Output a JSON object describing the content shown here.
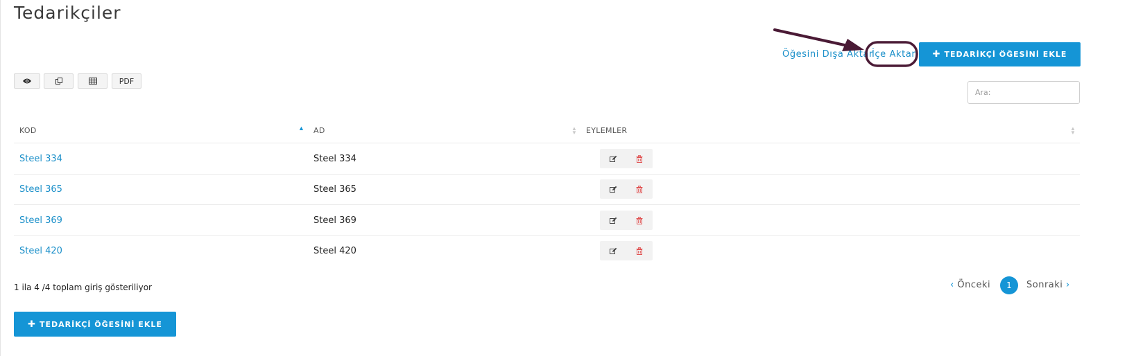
{
  "page": {
    "title": "Tedarikçiler"
  },
  "header_actions": {
    "export_label": "Öğesini Dışa Aktar",
    "import_label": "İçe Aktar",
    "add_label": "TEDARİKÇİ ÖĞESİNİ EKLE"
  },
  "toolbar": {
    "buttons": [
      {
        "icon": "eye-icon"
      },
      {
        "icon": "copy-icon"
      },
      {
        "icon": "table-icon"
      },
      {
        "label": "PDF"
      }
    ]
  },
  "search": {
    "placeholder": "Ara:"
  },
  "table": {
    "columns": [
      "KOD",
      "AD",
      "EYLEMLER"
    ],
    "sort": {
      "column": "KOD",
      "direction": "ascending"
    },
    "rows": [
      {
        "kod": "Steel 334",
        "ad": "Steel 334"
      },
      {
        "kod": "Steel 365",
        "ad": "Steel 365"
      },
      {
        "kod": "Steel 369",
        "ad": "Steel 369"
      },
      {
        "kod": "Steel 420",
        "ad": "Steel 420"
      }
    ],
    "row_actions": [
      {
        "icon": "edit-icon",
        "color": "#444444"
      },
      {
        "icon": "trash-icon",
        "color": "#e05454"
      }
    ]
  },
  "footer": {
    "info": "1 ila 4 /4 toplam giriş gösteriliyor",
    "pagination": {
      "prev": "Önceki",
      "current": "1",
      "next": "Sonraki"
    }
  },
  "bottom_actions": {
    "add_label": "TEDARİKÇİ ÖĞESİNİ EKLE"
  },
  "colors": {
    "accent": "#1595d6",
    "link": "#1a8fc9",
    "annotation": "#4a1a35",
    "delete": "#e05454"
  }
}
